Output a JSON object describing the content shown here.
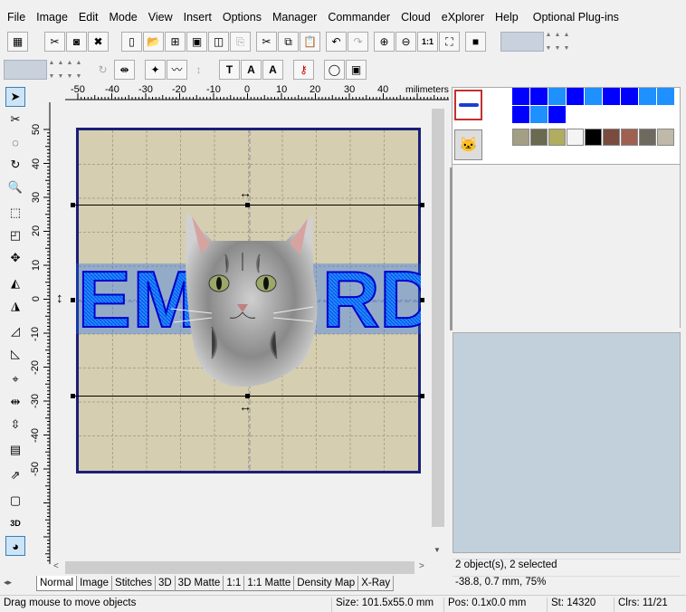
{
  "menu": [
    "File",
    "Image",
    "Edit",
    "Mode",
    "View",
    "Insert",
    "Options",
    "Manager",
    "Commander",
    "Cloud",
    "eXplorer",
    "Help",
    "Optional Plug-ins"
  ],
  "ruler": {
    "unit": "milimeters",
    "h_ticks": [
      "-50",
      "-40",
      "-30",
      "-20",
      "-10",
      "0",
      "10",
      "20",
      "30",
      "40"
    ],
    "v_ticks": [
      "50",
      "40",
      "30",
      "20",
      "10",
      "0",
      "-10",
      "-20",
      "-30",
      "-40",
      "-50"
    ]
  },
  "design": {
    "lettering": "EMBROIDERY",
    "visible_letters_left": "EM",
    "visible_letters_right": "RD"
  },
  "tabs": [
    "Normal",
    "Image",
    "Stitches",
    "3D",
    "3D Matte",
    "1:1",
    "1:1 Matte",
    "Density Map",
    "X-Ray"
  ],
  "palette": {
    "row1": [
      "#0000ff",
      "#0000ff",
      "#1e90ff",
      "#0000ff",
      "#1e90ff",
      "#0000ff",
      "#0000ff",
      "#1e90ff",
      "#1e90ff"
    ],
    "row2": [
      "#0000ff",
      "#1e90ff",
      "#0000ff"
    ],
    "row3": [
      "#a39f84",
      "#6a6a50",
      "#b0ac60",
      "#f4f4f4",
      "#000000",
      "#7a4b3f",
      "#a06050",
      "#6f6a60",
      "#c0b8a8"
    ]
  },
  "info": {
    "objects": "2 object(s), 2 selected",
    "coords": "-38.8, 0.7 mm, 75%"
  },
  "status": {
    "hint": "Drag mouse to move objects",
    "size": "Size: 101.5x55.0 mm",
    "pos": "Pos: 0.1x0.0 mm",
    "st": "St: 14320",
    "clrs": "Clrs: 11/21"
  }
}
